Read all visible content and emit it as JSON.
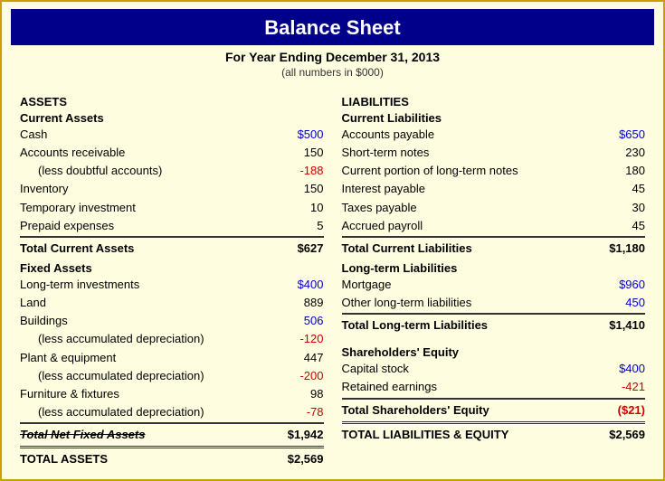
{
  "header": {
    "title": "Balance Sheet",
    "subtitle": "For Year Ending December 31, 2013",
    "note": "(all numbers in $000)"
  },
  "assets": {
    "section": "ASSETS",
    "current": {
      "label": "Current Assets",
      "items": [
        {
          "name": "Cash",
          "value": "$500",
          "class": "blue"
        },
        {
          "name": "Accounts receivable",
          "value": "150",
          "class": ""
        },
        {
          "name": "(less doubtful accounts)",
          "value": "-188",
          "class": "red",
          "indent": true
        },
        {
          "name": "Inventory",
          "value": "150",
          "class": ""
        },
        {
          "name": "Temporary investment",
          "value": "10",
          "class": ""
        },
        {
          "name": "Prepaid expenses",
          "value": "5",
          "class": ""
        }
      ],
      "total_label": "Total Current Assets",
      "total_value": "$627"
    },
    "fixed": {
      "label": "Fixed Assets",
      "items": [
        {
          "name": "Long-term investments",
          "value": "$400",
          "class": "blue"
        },
        {
          "name": "Land",
          "value": "889",
          "class": ""
        },
        {
          "name": "Buildings",
          "value": "506",
          "class": "blue"
        },
        {
          "name": "(less accumulated depreciation)",
          "value": "-120",
          "class": "red",
          "indent": true
        },
        {
          "name": "Plant & equipment",
          "value": "447",
          "class": ""
        },
        {
          "name": "(less accumulated depreciation)",
          "value": "-200",
          "class": "red",
          "indent": true
        },
        {
          "name": "Furniture & fixtures",
          "value": "98",
          "class": ""
        },
        {
          "name": "(less accumulated depreciation)",
          "value": "-78",
          "class": "red",
          "indent": true
        }
      ],
      "total_label": "Total Net Fixed Assets",
      "total_value": "$1,942"
    },
    "grand_total_label": "TOTAL ASSETS",
    "grand_total_value": "$2,569"
  },
  "liabilities": {
    "section": "LIABILITIES",
    "current": {
      "label": "Current Liabilities",
      "items": [
        {
          "name": "Accounts payable",
          "value": "$650",
          "class": "blue"
        },
        {
          "name": "Short-term notes",
          "value": "230",
          "class": ""
        },
        {
          "name": "Current portion of long-term notes",
          "value": "180",
          "class": ""
        },
        {
          "name": "Interest payable",
          "value": "45",
          "class": ""
        },
        {
          "name": "Taxes payable",
          "value": "30",
          "class": ""
        },
        {
          "name": "Accrued payroll",
          "value": "45",
          "class": ""
        }
      ],
      "total_label": "Total Current Liabilities",
      "total_value": "$1,180"
    },
    "longterm": {
      "label": "Long-term Liabilities",
      "items": [
        {
          "name": "Mortgage",
          "value": "$960",
          "class": "blue"
        },
        {
          "name": "Other long-term liabilities",
          "value": "450",
          "class": "blue"
        }
      ],
      "total_label": "Total Long-term Liabilities",
      "total_value": "$1,410"
    },
    "equity": {
      "label": "Shareholders' Equity",
      "items": [
        {
          "name": "Capital stock",
          "value": "$400",
          "class": "blue"
        },
        {
          "name": "Retained earnings",
          "value": "-421",
          "class": "red"
        }
      ],
      "total_label": "Total Shareholders' Equity",
      "total_value": "($21)"
    },
    "grand_total_label": "TOTAL LIABILITIES & EQUITY",
    "grand_total_value": "$2,569"
  }
}
